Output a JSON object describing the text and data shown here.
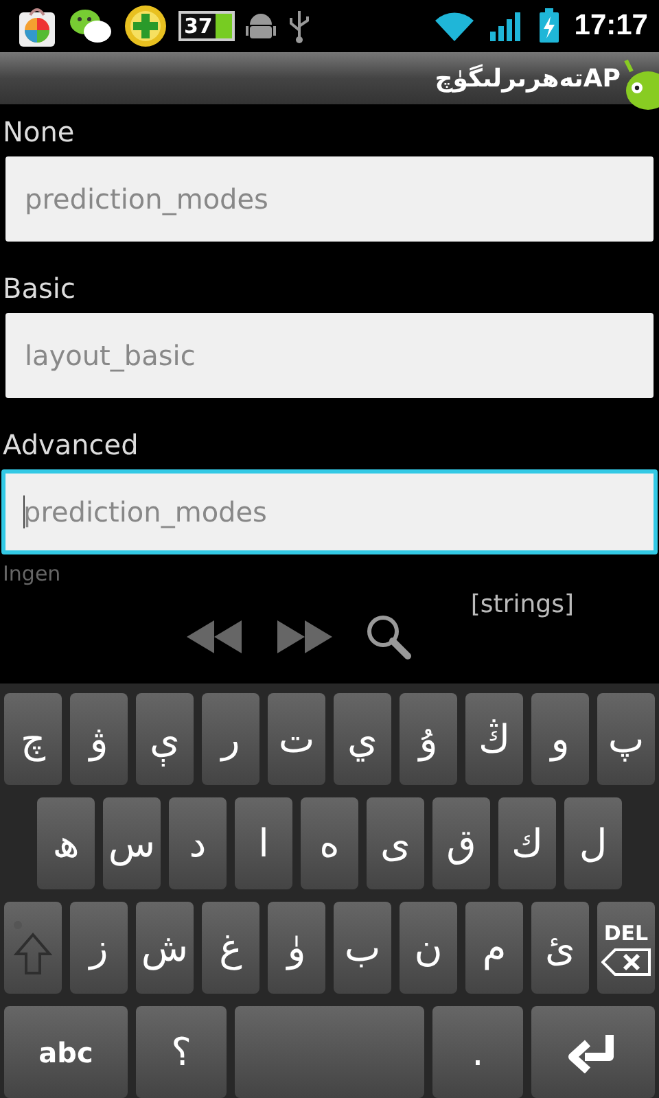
{
  "status_bar": {
    "battery_badge": "37",
    "time": "17:17"
  },
  "title_bar": {
    "title": "APتەھرىرلىگۈچ"
  },
  "fields": [
    {
      "label": "None",
      "value": "prediction_modes",
      "focused": false
    },
    {
      "label": "Basic",
      "value": "layout_basic",
      "focused": false
    },
    {
      "label": "Advanced",
      "value": "prediction_modes",
      "focused": true
    }
  ],
  "next_label": "Ingen",
  "toolbar": {
    "tag": "[strings]"
  },
  "keyboard": {
    "rows": [
      [
        {
          "kind": "char",
          "label": "چ"
        },
        {
          "kind": "char",
          "label": "ۋ"
        },
        {
          "kind": "char",
          "label": "ې"
        },
        {
          "kind": "char",
          "label": "ر"
        },
        {
          "kind": "char",
          "label": "ت"
        },
        {
          "kind": "char",
          "label": "ي"
        },
        {
          "kind": "char",
          "label": "ۇ"
        },
        {
          "kind": "char",
          "label": "ڭ"
        },
        {
          "kind": "char",
          "label": "و"
        },
        {
          "kind": "char",
          "label": "پ"
        }
      ],
      [
        {
          "kind": "char",
          "label": "ھ"
        },
        {
          "kind": "char",
          "label": "س"
        },
        {
          "kind": "char",
          "label": "د"
        },
        {
          "kind": "char",
          "label": "ا"
        },
        {
          "kind": "char",
          "label": "ە"
        },
        {
          "kind": "char",
          "label": "ى"
        },
        {
          "kind": "char",
          "label": "ق"
        },
        {
          "kind": "char",
          "label": "ك"
        },
        {
          "kind": "char",
          "label": "ل"
        }
      ],
      [
        {
          "kind": "shift"
        },
        {
          "kind": "char",
          "label": "ز"
        },
        {
          "kind": "char",
          "label": "ش"
        },
        {
          "kind": "char",
          "label": "غ"
        },
        {
          "kind": "char",
          "label": "ۈ"
        },
        {
          "kind": "char",
          "label": "ب"
        },
        {
          "kind": "char",
          "label": "ن"
        },
        {
          "kind": "char",
          "label": "م"
        },
        {
          "kind": "char",
          "label": "ئ"
        },
        {
          "kind": "delete",
          "label": "DEL"
        }
      ],
      [
        {
          "kind": "mode",
          "label": "abc"
        },
        {
          "kind": "char",
          "label": "؟"
        },
        {
          "kind": "space"
        },
        {
          "kind": "char",
          "label": "."
        },
        {
          "kind": "enter"
        }
      ]
    ]
  }
}
